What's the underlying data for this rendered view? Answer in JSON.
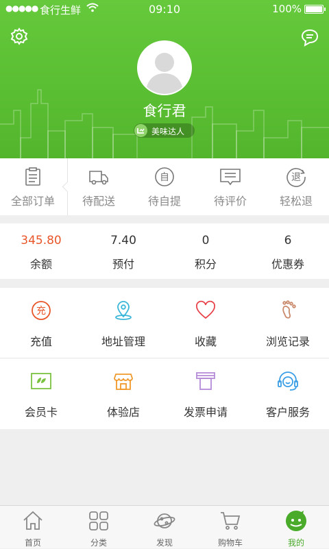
{
  "status_bar": {
    "signal": "●●●●●",
    "carrier": "食行生鲜",
    "time": "09:10",
    "battery": "100%"
  },
  "profile": {
    "username": "食行君",
    "badge": "美味达人"
  },
  "header_icons": {
    "settings": "gear-icon",
    "messages": "message-icon"
  },
  "orders": [
    {
      "label": "全部订单",
      "icon": "clipboard-icon"
    },
    {
      "label": "待配送",
      "icon": "truck-icon"
    },
    {
      "label": "待自提",
      "icon": "self-pickup-icon",
      "glyph": "自"
    },
    {
      "label": "待评价",
      "icon": "comment-icon"
    },
    {
      "label": "轻松退",
      "icon": "refund-icon",
      "glyph": "退"
    }
  ],
  "stats": [
    {
      "value": "345.80",
      "label": "余额"
    },
    {
      "value": "7.40",
      "label": "预付"
    },
    {
      "value": "0",
      "label": "积分"
    },
    {
      "value": "6",
      "label": "优惠券"
    }
  ],
  "features": [
    {
      "label": "充值",
      "icon": "recharge-icon",
      "glyph": "充",
      "color": "#e8562a"
    },
    {
      "label": "地址管理",
      "icon": "location-pin-icon",
      "color": "#3bb6d8"
    },
    {
      "label": "收藏",
      "icon": "heart-icon",
      "color": "#e8434a"
    },
    {
      "label": "浏览记录",
      "icon": "footprint-icon",
      "color": "#c9896a"
    },
    {
      "label": "会员卡",
      "icon": "member-card-icon",
      "color": "#7cc242"
    },
    {
      "label": "体验店",
      "icon": "store-icon",
      "color": "#f0992b"
    },
    {
      "label": "发票申请",
      "icon": "invoice-icon",
      "color": "#b48ad8"
    },
    {
      "label": "客户服务",
      "icon": "headset-icon",
      "color": "#3a9ee6"
    }
  ],
  "tabs": [
    {
      "label": "首页",
      "icon": "home-icon"
    },
    {
      "label": "分类",
      "icon": "category-icon"
    },
    {
      "label": "发现",
      "icon": "planet-icon"
    },
    {
      "label": "购物车",
      "icon": "cart-icon"
    },
    {
      "label": "我的",
      "icon": "profile-icon",
      "active": true
    }
  ],
  "colors": {
    "brand_green": "#5bbf33",
    "active_tab": "#4aaa2a",
    "balance_red": "#e8562a"
  }
}
